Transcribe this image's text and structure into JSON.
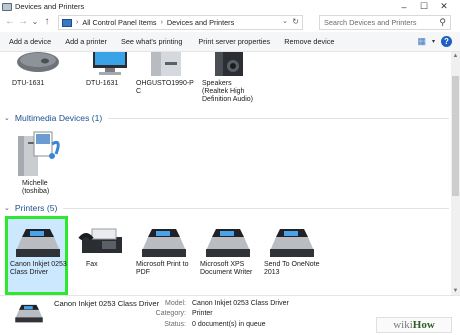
{
  "window": {
    "title": "Devices and Printers",
    "controls": [
      "–",
      "☐",
      "✕"
    ]
  },
  "nav": {
    "back": "←",
    "forward": "→",
    "recent": "⌄",
    "up": "↑"
  },
  "address": {
    "crumbs": [
      "All Control Panel Items",
      "Devices and Printers"
    ],
    "separator": "›"
  },
  "search": {
    "placeholder": "Search Devices and Printers"
  },
  "commands": [
    "Add a device",
    "Add a printer",
    "See what's printing",
    "Print server properties",
    "Remove device"
  ],
  "top_devices": [
    {
      "label": "DTU-1631",
      "icon": "mouse-icon"
    },
    {
      "label": "DTU-1631",
      "icon": "monitor-icon"
    },
    {
      "label": "OHGUSTO1990-P C",
      "icon": "computer-tower-icon"
    },
    {
      "label": "Speakers (Realtek High Definition Audio)",
      "icon": "speaker-icon"
    }
  ],
  "multimedia": {
    "header": "Multimedia Devices (1)",
    "devices": [
      {
        "label": "Michelle (toshiba)",
        "icon": "media-server-icon"
      }
    ]
  },
  "printers": {
    "header": "Printers (5)",
    "devices": [
      {
        "label": "Canon Inkjet 0253 Class Driver",
        "icon": "printer-icon",
        "selected": true
      },
      {
        "label": "Fax",
        "icon": "fax-icon"
      },
      {
        "label": "Microsoft Print to PDF",
        "icon": "printer-icon"
      },
      {
        "label": "Microsoft XPS Document Writer",
        "icon": "printer-icon"
      },
      {
        "label": "Send To OneNote 2013",
        "icon": "printer-icon"
      }
    ]
  },
  "details": {
    "name": "Canon Inkjet 0253 Class Driver",
    "model_key": "Model:",
    "model_val": "Canon Inkjet 0253 Class Driver",
    "category_key": "Category:",
    "category_val": "Printer",
    "status_key": "Status:",
    "status_val": "0 document(s) in queue"
  },
  "watermark": {
    "part1": "wiki",
    "part2": "How"
  },
  "colors": {
    "accent": "#1d4f91",
    "selection": "#cce8ff",
    "highlight_border": "#2ee82e"
  }
}
